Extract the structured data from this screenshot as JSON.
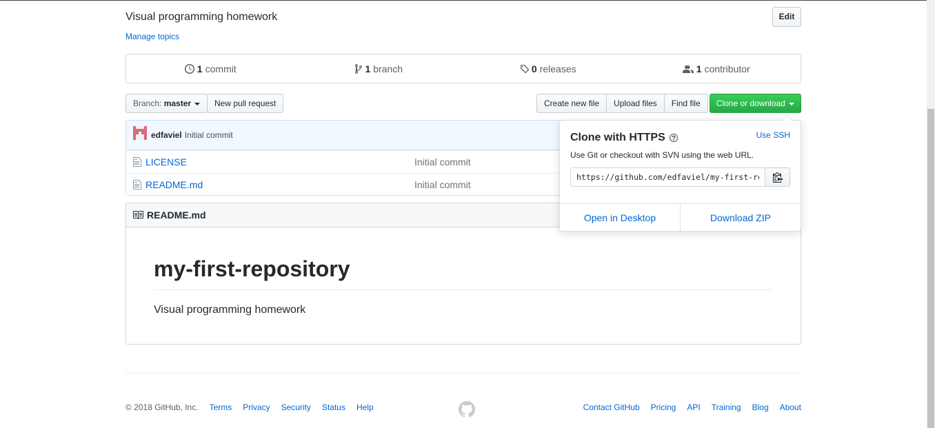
{
  "repo": {
    "description": "Visual programming homework",
    "edit_label": "Edit",
    "manage_topics": "Manage topics"
  },
  "summary": {
    "commits": {
      "num": "1",
      "label": "commit"
    },
    "branches": {
      "num": "1",
      "label": "branch"
    },
    "releases": {
      "num": "0",
      "label": "releases"
    },
    "contributors": {
      "num": "1",
      "label": "contributor"
    }
  },
  "toolbar": {
    "branch_prefix": "Branch:",
    "branch_name": "master",
    "new_pr": "New pull request",
    "create_file": "Create new file",
    "upload_files": "Upload files",
    "find_file": "Find file",
    "clone": "Clone or download"
  },
  "commit": {
    "author": "edfaviel",
    "message": "Initial commit"
  },
  "files": [
    {
      "name": "LICENSE",
      "commit": "Initial commit"
    },
    {
      "name": "README.md",
      "commit": "Initial commit"
    }
  ],
  "readme": {
    "filename": "README.md",
    "heading": "my-first-repository",
    "text": "Visual programming homework"
  },
  "clone_dropdown": {
    "title": "Clone with HTTPS",
    "use_ssh": "Use SSH",
    "help": "Use Git or checkout with SVN using the web URL.",
    "url": "https://github.com/edfaviel/my-first-repository.git",
    "open_desktop": "Open in Desktop",
    "download_zip": "Download ZIP"
  },
  "footer": {
    "copyright": "© 2018 GitHub, Inc.",
    "left_links": [
      "Terms",
      "Privacy",
      "Security",
      "Status",
      "Help"
    ],
    "right_links": [
      "Contact GitHub",
      "Pricing",
      "API",
      "Training",
      "Blog",
      "About"
    ]
  },
  "colors": {
    "link": "#0366d6",
    "clone_button": "#28a745",
    "commit_bar": "#f1f8ff"
  }
}
